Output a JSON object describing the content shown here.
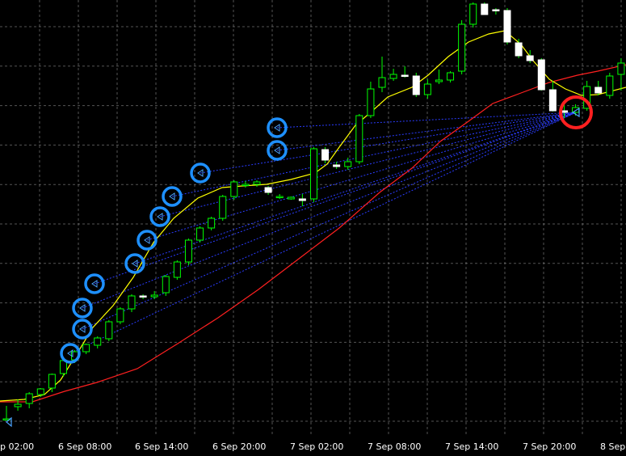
{
  "chart_data": {
    "type": "candlestick",
    "grid": true,
    "x_tick_labels": [
      "p 02:00",
      "6 Sep 08:00",
      "6 Sep 14:00",
      "6 Sep 20:00",
      "7 Sep 02:00",
      "7 Sep 08:00",
      "7 Sep 14:00",
      "7 Sep 20:00",
      "8 Sep"
    ],
    "colors": {
      "background": "#000000",
      "grid": "#9a9a9a",
      "bull_candle": "#00ff00",
      "bear_candle_body": "#ffffff",
      "fast_ma": "#ffff00",
      "slow_ma": "#ff2020",
      "signal_lines": "#2a3cff",
      "entry_markers": "#1e90ff",
      "exit_marker": "#ff2020",
      "arrow": "#4aa3ff"
    },
    "y_range": [
      0,
      564
    ],
    "candles": [
      [
        519,
        519,
        502,
        518
      ],
      [
        503,
        508,
        494,
        500
      ],
      [
        499,
        505,
        485,
        487
      ],
      [
        488,
        491,
        480,
        481
      ],
      [
        480,
        485,
        462,
        463
      ],
      [
        462,
        466,
        445,
        446
      ],
      [
        445,
        449,
        433,
        435
      ],
      [
        435,
        438,
        425,
        426
      ],
      [
        427,
        431,
        416,
        418
      ],
      [
        419,
        422,
        396,
        398
      ],
      [
        398,
        401,
        380,
        382
      ],
      [
        382,
        386,
        364,
        366
      ],
      [
        366,
        370,
        364,
        367
      ],
      [
        367,
        370,
        360,
        365
      ],
      [
        362,
        366,
        340,
        342
      ],
      [
        343,
        346,
        322,
        324
      ],
      [
        324,
        328,
        295,
        297
      ],
      [
        297,
        300,
        280,
        282
      ],
      [
        282,
        285,
        268,
        270
      ],
      [
        270,
        273,
        241,
        243
      ],
      [
        243,
        247,
        223,
        225
      ],
      [
        229,
        232,
        224,
        228
      ],
      [
        228,
        231,
        223,
        225
      ],
      [
        232,
        241,
        230,
        238
      ],
      [
        244,
        246,
        240,
        243
      ],
      [
        246,
        247,
        243,
        244
      ],
      [
        246,
        255,
        240,
        248
      ],
      [
        246,
        250,
        182,
        184
      ],
      [
        185,
        202,
        182,
        198
      ],
      [
        204,
        209,
        200,
        206
      ],
      [
        206,
        210,
        195,
        200
      ],
      [
        200,
        203,
        141,
        143
      ],
      [
        143,
        146,
        101,
        110
      ],
      [
        108,
        114,
        70,
        96
      ],
      [
        97,
        100,
        85,
        92
      ],
      [
        93,
        96,
        82,
        94
      ],
      [
        94,
        120,
        90,
        117
      ],
      [
        117,
        122,
        98,
        104
      ],
      [
        101,
        104,
        86,
        99
      ],
      [
        99,
        102,
        88,
        90
      ],
      [
        88,
        92,
        25,
        30
      ],
      [
        30,
        34,
        3,
        5
      ],
      [
        5,
        7,
        3,
        18
      ],
      [
        12,
        18,
        10,
        13
      ],
      [
        13,
        55,
        10,
        52
      ],
      [
        53,
        72,
        48,
        69
      ],
      [
        69,
        78,
        62,
        75
      ],
      [
        74,
        112,
        72,
        111
      ],
      [
        111,
        138,
        100,
        137
      ],
      [
        137,
        146,
        128,
        139
      ],
      [
        139,
        143,
        129,
        133
      ],
      [
        134,
        137,
        100,
        107
      ],
      [
        108,
        118,
        100,
        115
      ],
      [
        118,
        122,
        90,
        94
      ],
      [
        92,
        112,
        72,
        78
      ]
    ],
    "fast_ma": [
      [
        0,
        496
      ],
      [
        30,
        494
      ],
      [
        55,
        488
      ],
      [
        75,
        470
      ],
      [
        95,
        438
      ],
      [
        115,
        405
      ],
      [
        140,
        378
      ],
      [
        165,
        343
      ],
      [
        190,
        300
      ],
      [
        215,
        270
      ],
      [
        245,
        245
      ],
      [
        275,
        232
      ],
      [
        300,
        230
      ],
      [
        330,
        228
      ],
      [
        360,
        222
      ],
      [
        390,
        214
      ],
      [
        405,
        203
      ],
      [
        420,
        182
      ],
      [
        440,
        155
      ],
      [
        460,
        138
      ],
      [
        480,
        120
      ],
      [
        510,
        108
      ],
      [
        530,
        93
      ],
      [
        555,
        70
      ],
      [
        580,
        52
      ],
      [
        605,
        42
      ],
      [
        625,
        38
      ],
      [
        645,
        55
      ],
      [
        660,
        75
      ],
      [
        680,
        98
      ],
      [
        700,
        110
      ],
      [
        720,
        118
      ],
      [
        740,
        117
      ],
      [
        775,
        108
      ]
    ],
    "slow_ma": [
      [
        0,
        497
      ],
      [
        40,
        497
      ],
      [
        80,
        484
      ],
      [
        120,
        473
      ],
      [
        170,
        456
      ],
      [
        220,
        425
      ],
      [
        270,
        393
      ],
      [
        320,
        358
      ],
      [
        370,
        320
      ],
      [
        420,
        282
      ],
      [
        470,
        238
      ],
      [
        510,
        208
      ],
      [
        545,
        175
      ],
      [
        580,
        150
      ],
      [
        610,
        128
      ],
      [
        645,
        115
      ],
      [
        680,
        102
      ],
      [
        715,
        93
      ],
      [
        740,
        88
      ],
      [
        775,
        80
      ]
    ],
    "signal_lines": [
      [
        [
          87,
          437
        ],
        [
          713,
          139
        ]
      ],
      [
        [
          102,
          407
        ],
        [
          713,
          139
        ]
      ],
      [
        [
          102,
          381
        ],
        [
          713,
          139
        ]
      ],
      [
        [
          117,
          351
        ],
        [
          713,
          139
        ]
      ],
      [
        [
          167,
          326
        ],
        [
          713,
          139
        ]
      ],
      [
        [
          182,
          297
        ],
        [
          713,
          139
        ]
      ],
      [
        [
          198,
          268
        ],
        [
          713,
          139
        ]
      ],
      [
        [
          213,
          243
        ],
        [
          713,
          139
        ]
      ],
      [
        [
          248,
          214
        ],
        [
          713,
          139
        ]
      ],
      [
        [
          343,
          186
        ],
        [
          713,
          139
        ]
      ],
      [
        [
          343,
          158
        ],
        [
          713,
          139
        ]
      ]
    ],
    "entry_markers": [
      [
        87,
        437
      ],
      [
        102,
        407
      ],
      [
        102,
        381
      ],
      [
        117,
        351
      ],
      [
        167,
        326
      ],
      [
        182,
        297
      ],
      [
        198,
        268
      ],
      [
        213,
        243
      ],
      [
        248,
        214
      ],
      [
        343,
        186
      ],
      [
        343,
        158
      ]
    ],
    "exit_marker": [
      713,
      139
    ],
    "extra_arrows": [
      [
        11,
        522
      ]
    ]
  }
}
